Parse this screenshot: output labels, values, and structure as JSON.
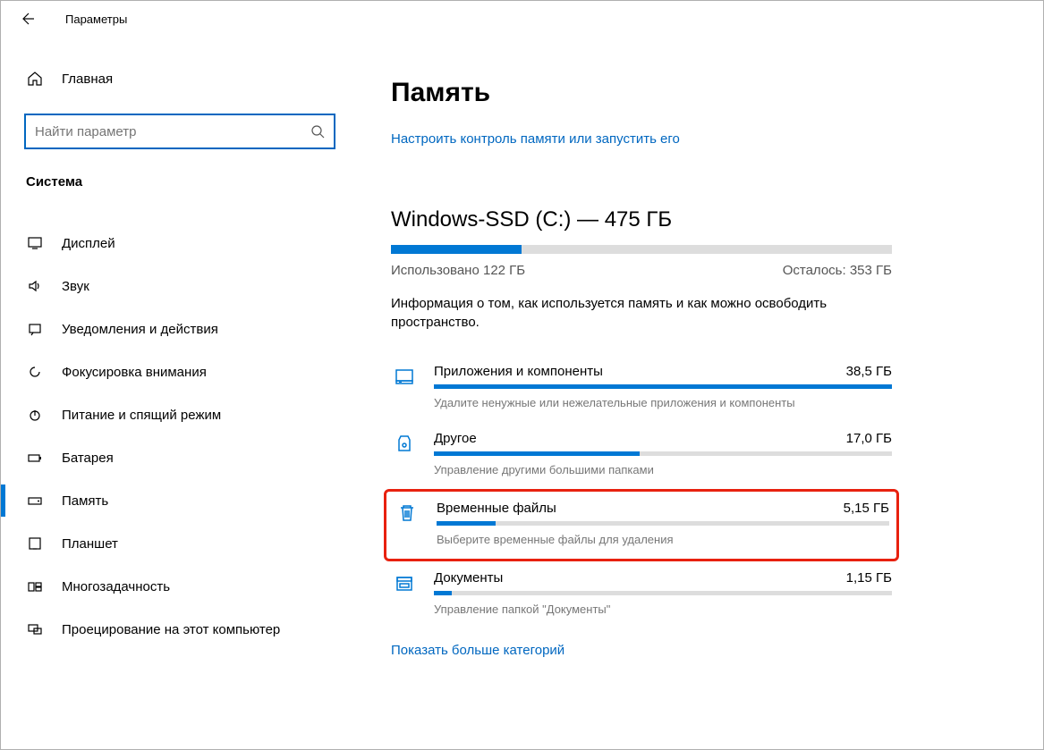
{
  "window": {
    "title": "Параметры"
  },
  "sidebar": {
    "home_label": "Главная",
    "search_placeholder": "Найти параметр",
    "section_label": "Система",
    "items": [
      {
        "label": "Дисплей",
        "icon": "display"
      },
      {
        "label": "Звук",
        "icon": "sound"
      },
      {
        "label": "Уведомления и действия",
        "icon": "notifications"
      },
      {
        "label": "Фокусировка внимания",
        "icon": "focus"
      },
      {
        "label": "Питание и спящий режим",
        "icon": "power"
      },
      {
        "label": "Батарея",
        "icon": "battery"
      },
      {
        "label": "Память",
        "icon": "storage",
        "selected": true
      },
      {
        "label": "Планшет",
        "icon": "tablet"
      },
      {
        "label": "Многозадачность",
        "icon": "multitask"
      },
      {
        "label": "Проецирование на этот компьютер",
        "icon": "project"
      }
    ]
  },
  "content": {
    "page_title": "Память",
    "configure_link": "Настроить контроль памяти или запустить его",
    "disk": {
      "name": "Windows-SSD (C:) — 475 ГБ",
      "used_pct": 26,
      "used_text": "Использовано 122 ГБ",
      "free_text": "Осталось: 353 ГБ",
      "description": "Информация о том, как используется память и как можно освободить пространство."
    },
    "categories": [
      {
        "title": "Приложения и компоненты",
        "size": "38,5 ГБ",
        "fill_pct": 100,
        "sub": "Удалите ненужные или нежелательные приложения и компоненты",
        "icon": "apps"
      },
      {
        "title": "Другое",
        "size": "17,0 ГБ",
        "fill_pct": 45,
        "sub": "Управление другими большими папками",
        "icon": "other"
      },
      {
        "title": "Временные файлы",
        "size": "5,15 ГБ",
        "fill_pct": 13,
        "sub": "Выберите временные файлы для удаления",
        "icon": "trash",
        "highlighted": true
      },
      {
        "title": "Документы",
        "size": "1,15 ГБ",
        "fill_pct": 4,
        "sub": "Управление папкой \"Документы\"",
        "icon": "docs"
      }
    ],
    "show_more": "Показать больше категорий"
  }
}
